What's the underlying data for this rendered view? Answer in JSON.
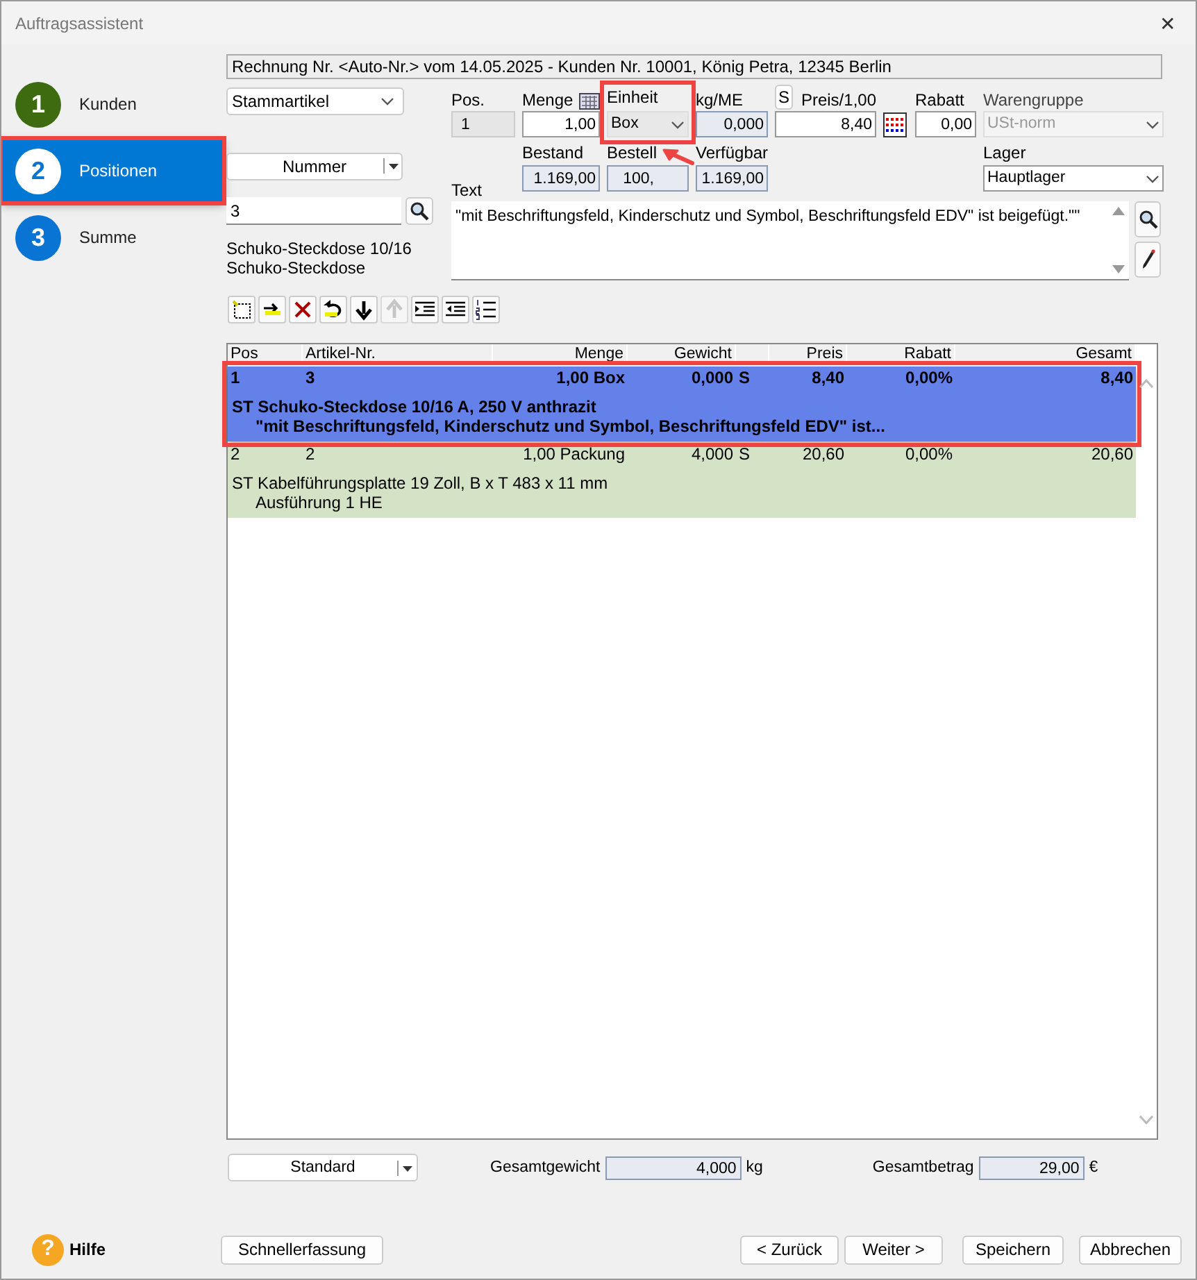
{
  "window": {
    "title": "Auftragsassistent",
    "close": "✕"
  },
  "steps": [
    {
      "number": "1",
      "label": "Kunden",
      "color": "#3f6b10",
      "selected": false,
      "highlighted": false
    },
    {
      "number": "2",
      "label": "Positionen",
      "color": "#ffffff",
      "selected": true,
      "highlighted": true
    },
    {
      "number": "3",
      "label": "Summe",
      "color": "#0a74d4",
      "selected": false,
      "highlighted": false
    }
  ],
  "header": "Rechnung Nr. <Auto-Nr.> vom 14.05.2025 - Kunden Nr. 10001, König Petra, 12345 Berlin",
  "article_source": {
    "value": "Stammartikel"
  },
  "search_mode": {
    "label": "Nummer"
  },
  "search_field": {
    "value": "3"
  },
  "article_lines": [
    "Schuko-Steckdose 10/16",
    "Schuko-Steckdose"
  ],
  "fields": {
    "pos": {
      "label": "Pos.",
      "value": "1"
    },
    "menge": {
      "label": "Menge",
      "value": "1,00"
    },
    "einheit": {
      "label": "Einheit",
      "value": "Box",
      "highlighted": true
    },
    "kg_me": {
      "label": "kg/ME",
      "value": "0,000"
    },
    "s_button": "S",
    "preis": {
      "label": "Preis/1,00",
      "value": "8,40"
    },
    "rabatt": {
      "label": "Rabatt",
      "value": "0,00"
    },
    "warengruppe": {
      "label": "Warengruppe",
      "value": "USt-norm",
      "disabled": true
    },
    "bestand": {
      "label": "Bestand",
      "value": "1.169,00"
    },
    "bestellt": {
      "label": "Bestell",
      "value": "100,"
    },
    "verfuegbar": {
      "label": "Verfügbar",
      "value": "1.169,00"
    },
    "lager": {
      "label": "Lager",
      "value": "Hauptlager"
    },
    "text": {
      "label": "Text",
      "value": "\"mit Beschriftungsfeld, Kinderschutz und Symbol, Beschriftungsfeld EDV\" ist beigefügt.\"\""
    }
  },
  "toolbar": [
    {
      "kind": "new",
      "disabled": false
    },
    {
      "kind": "insert",
      "disabled": false
    },
    {
      "kind": "delete",
      "disabled": false
    },
    {
      "kind": "undo",
      "disabled": false
    },
    {
      "kind": "down",
      "disabled": false
    },
    {
      "kind": "up",
      "disabled": true
    },
    {
      "kind": "indent",
      "disabled": false
    },
    {
      "kind": "outdent",
      "disabled": false
    },
    {
      "kind": "numbering",
      "disabled": false
    }
  ],
  "table": {
    "columns": [
      "Pos",
      "Artikel-Nr.",
      "Menge",
      "Gewicht",
      "",
      "Preis",
      "Rabatt",
      "Gesamt"
    ],
    "rows": [
      {
        "cells": [
          "1",
          "3",
          "1,00 Box",
          "0,000",
          "S",
          "8,40",
          "0,00%",
          "8,40"
        ],
        "lines": [
          "ST Schuko-Steckdose 10/16 A, 250 V anthrazit",
          "\"mit Beschriftungsfeld, Kinderschutz und Symbol, Beschriftungsfeld EDV\" ist..."
        ],
        "selected": true,
        "highlighted": true
      },
      {
        "cells": [
          "2",
          "2",
          "1,00 Packung",
          "4,000",
          "S",
          "20,60",
          "0,00%",
          "20,60"
        ],
        "lines": [
          "ST Kabelführungsplatte 19 Zoll, B x T 483 x 11 mm",
          "Ausführung 1 HE"
        ],
        "selected": false,
        "highlighted": false
      }
    ]
  },
  "view_mode": {
    "label": "Standard"
  },
  "totals": [
    {
      "label": "Gesamtgewicht",
      "value": "4,000",
      "unit": "kg"
    },
    {
      "label": "Gesamtbetrag",
      "value": "29,00",
      "unit": "€"
    }
  ],
  "help": {
    "icon": "?",
    "label": "Hilfe"
  },
  "buttons": [
    {
      "label": "Schnellerfassung"
    },
    {
      "label": "< Zurück"
    },
    {
      "label": "Weiter >"
    },
    {
      "label": "Speichern"
    },
    {
      "label": "Abbrechen"
    }
  ],
  "annotation": {
    "arrow": true
  }
}
